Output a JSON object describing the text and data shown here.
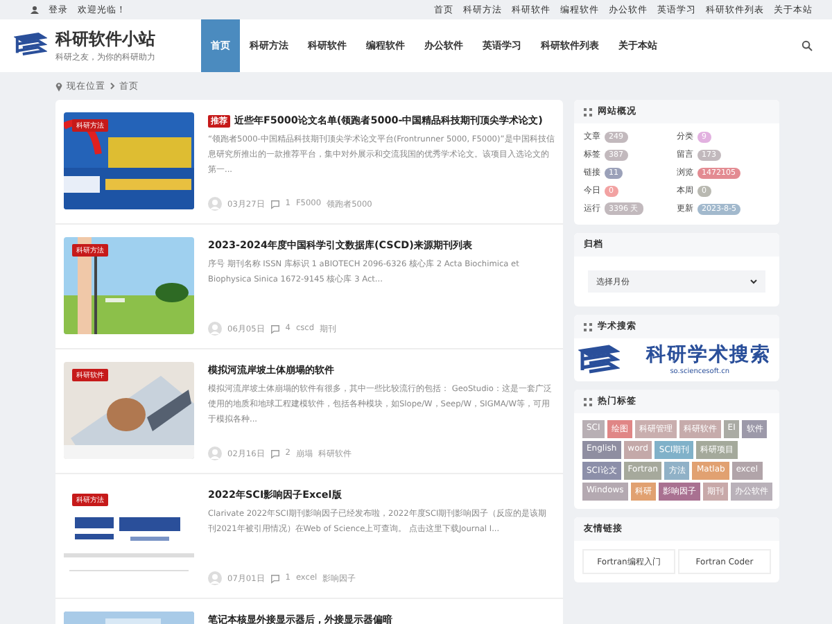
{
  "top_bar": {
    "login": "登录",
    "welcome": "欢迎光临！",
    "links": [
      "首页",
      "科研方法",
      "科研软件",
      "编程软件",
      "办公软件",
      "英语学习",
      "科研软件列表",
      "关于本站"
    ]
  },
  "header": {
    "site_title": "科研软件小站",
    "tagline": "科研之友，为你的科研助力",
    "nav": [
      {
        "label": "首页",
        "selected": true
      },
      {
        "label": "科研方法",
        "selected": false
      },
      {
        "label": "科研软件",
        "selected": false
      },
      {
        "label": "编程软件",
        "selected": false
      },
      {
        "label": "办公软件",
        "selected": false
      },
      {
        "label": "英语学习",
        "selected": false
      },
      {
        "label": "科研软件列表",
        "selected": false
      },
      {
        "label": "关于本站",
        "selected": false
      }
    ]
  },
  "breadcrumb": {
    "label": "现在位置",
    "current": "首页"
  },
  "posts": [
    {
      "category": "科研方法",
      "badge": "推荐",
      "title": "近些年F5000论文名单(领跑者5000-中国精品科技期刊顶尖学术论文)",
      "excerpt": "“领跑者5000-中国精品科技期刊顶尖学术论文平台(Frontrunner 5000, F5000)”是中国科技信息研究所推出的一款推荐平台，集中对外展示和交流我国的优秀学术论文。该项目入选论文的第一...",
      "date": "03月27日",
      "comments": "1",
      "tags": [
        "F5000",
        "领跑者5000"
      ]
    },
    {
      "category": "科研方法",
      "title": "2023-2024年度中国科学引文数据库(CSCD)来源期刊列表",
      "excerpt": "序号 期刊名称 ISSN 库标识 1 aBIOTECH 2096-6326 核心库 2 Acta Biochimica et Biophysica Sinica 1672-9145 核心库 3 Act...",
      "date": "06月05日",
      "comments": "4",
      "tags": [
        "cscd",
        "期刊"
      ]
    },
    {
      "category": "科研软件",
      "title": "模拟河流岸坡土体崩塌的软件",
      "excerpt": "模拟河流岸坡土体崩塌的软件有很多，其中一些比较流行的包括： GeoStudio：这是一套广泛使用的地质和地球工程建模软件，包括各种模块，如Slope/W，Seep/W，SIGMA/W等，可用于模拟各种...",
      "date": "02月16日",
      "comments": "2",
      "tags": [
        "崩塌",
        "科研软件"
      ]
    },
    {
      "category": "科研方法",
      "title": "2022年SCI影响因子Excel版",
      "excerpt": "Clarivate 2022年SCI期刊影响因子已经发布啦，2022年度SCI期刊影响因子（反应的是该期刊2021年被引用情况）在Web of Science上可查询。 点击这里下载Journal I...",
      "date": "07月01日",
      "comments": "1",
      "tags": [
        "excel",
        "影响因子"
      ]
    },
    {
      "title": "笔记本核显外接显示器后，外接显示器偏暗"
    }
  ],
  "sidebar": {
    "overview": {
      "title": "网站概况",
      "stats": [
        {
          "label": "文章",
          "value": "249",
          "color": "#c2b9bd"
        },
        {
          "label": "分类",
          "value": "9",
          "color": "#e2b1e0"
        },
        {
          "label": "标签",
          "value": "387",
          "color": "#c2b9bd"
        },
        {
          "label": "留言",
          "value": "173",
          "color": "#c2b9bd"
        },
        {
          "label": "链接",
          "value": "11",
          "color": "#9ba1b9"
        },
        {
          "label": "浏览",
          "value": "1472105",
          "color": "#e38b92"
        },
        {
          "label": "今日",
          "value": "0",
          "color": "#f2a2a2"
        },
        {
          "label": "本周",
          "value": "0",
          "color": "#b9b9b1"
        },
        {
          "label": "运行",
          "value": "3396 天",
          "color": "#c2b9bd"
        },
        {
          "label": "更新",
          "value": "2023-8-5",
          "color": "#a2b9cd"
        }
      ]
    },
    "archive": {
      "title": "归档",
      "select": "选择月份"
    },
    "search": {
      "title": "学术搜索",
      "logo_text": "科研学术搜索",
      "url": "so.sciencesoft.cn"
    },
    "tags": {
      "title": "热门标签",
      "items": [
        {
          "label": "SCI",
          "color": "#b8afb4"
        },
        {
          "label": "绘图",
          "color": "#e08686"
        },
        {
          "label": "科研管理",
          "color": "#c9aeae"
        },
        {
          "label": "科研软件",
          "color": "#c6abab"
        },
        {
          "label": "EI",
          "color": "#aaaba4"
        },
        {
          "label": "软件",
          "color": "#9c99a9"
        },
        {
          "label": "English",
          "color": "#8f8ea1"
        },
        {
          "label": "word",
          "color": "#c4a9a9"
        },
        {
          "label": "SCI期刊",
          "color": "#80b1c9"
        },
        {
          "label": "科研项目",
          "color": "#a4a99b"
        },
        {
          "label": "SCI论文",
          "color": "#8c8fa9"
        },
        {
          "label": "Fortran",
          "color": "#a6a99c"
        },
        {
          "label": "方法",
          "color": "#90b1c7"
        },
        {
          "label": "Matlab",
          "color": "#e1a171"
        },
        {
          "label": "excel",
          "color": "#b1a4a9"
        },
        {
          "label": "Windows",
          "color": "#b4a9b1"
        },
        {
          "label": "科研",
          "color": "#e1a171"
        },
        {
          "label": "影响因子",
          "color": "#a97191"
        },
        {
          "label": "期刊",
          "color": "#c8a9a9"
        },
        {
          "label": "办公软件",
          "color": "#b9b1b9"
        }
      ]
    },
    "links": {
      "title": "友情链接",
      "items": [
        "Fortran编程入门",
        "Fortran Coder"
      ]
    }
  }
}
